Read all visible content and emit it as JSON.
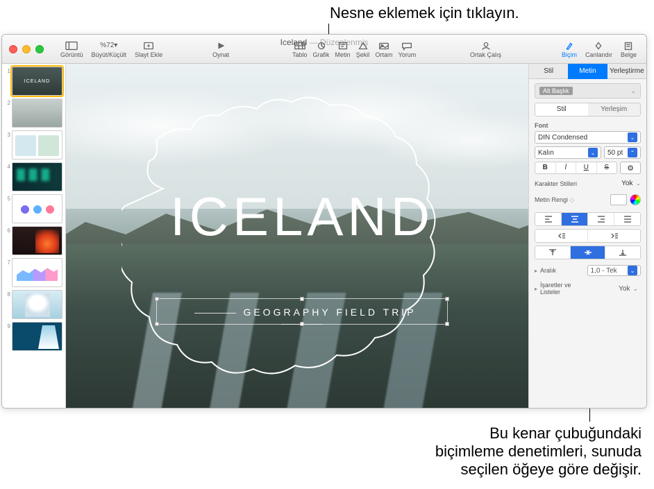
{
  "annotations": {
    "top": "Nesne eklemek için tıklayın.",
    "bottom_l1": "Bu kenar çubuğundaki",
    "bottom_l2": "biçimleme denetimleri, sunuda",
    "bottom_l3": "seçilen öğeye göre değişir."
  },
  "title": {
    "name": "Iceland",
    "status": "Düzenlenmiş"
  },
  "toolbar": {
    "view": "Görüntü",
    "zoom": "Büyüt/Küçült",
    "zoom_value": "%72",
    "add_slide": "Slayt Ekle",
    "play": "Oynat",
    "table": "Tablo",
    "chart": "Grafik",
    "text": "Metin",
    "shape": "Şekil",
    "media": "Ortam",
    "comment": "Yorum",
    "collaborate": "Ortak Çalış",
    "format": "Biçim",
    "animate": "Canlandır",
    "document": "Belge"
  },
  "slide": {
    "title": "ICELAND",
    "subtitle": "GEOGRAPHY FIELD TRIP"
  },
  "thumbs": [
    "1",
    "2",
    "3",
    "4",
    "5",
    "6",
    "7",
    "8",
    "9"
  ],
  "inspector": {
    "tabs": {
      "style": "Stil",
      "text": "Metin",
      "arrange": "Yerleştirme"
    },
    "paragraph_style": "Alt Başlık",
    "subtabs": {
      "style": "Stil",
      "layout": "Yerleşim"
    },
    "font_label": "Font",
    "font_family": "DIN Condensed",
    "font_weight": "Kalın",
    "font_size": "50 pt",
    "bold": "B",
    "italic": "İ",
    "underline": "U",
    "strike": "S",
    "char_styles_label": "Karakter Stilleri",
    "char_styles_value": "Yok",
    "text_color_label": "Metin Rengi",
    "spacing_label": "Aralık",
    "spacing_value": "1,0 - Tek",
    "bullets_label": "İşaretler ve Listeler",
    "bullets_value": "Yok"
  }
}
